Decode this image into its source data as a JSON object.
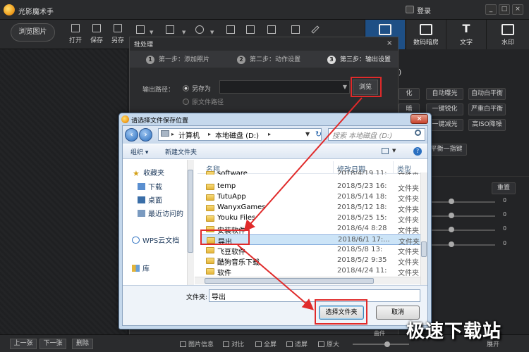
{
  "window": {
    "title": "光影魔术手",
    "login": "登录",
    "controls": [
      "_",
      "□",
      "×"
    ]
  },
  "toolbar": {
    "browse_pictures": "浏览图片",
    "items": [
      "打开",
      "保存",
      "另存"
    ],
    "right_tabs": [
      {
        "label": "",
        "icon": "edit-icon",
        "active": true
      },
      {
        "label": "数码暗房",
        "icon": "camera-icon",
        "active": false
      },
      {
        "label": "文字",
        "icon": "text-icon",
        "active": false
      },
      {
        "label": "水印",
        "icon": "watermark-icon",
        "active": false
      }
    ]
  },
  "right_panel": {
    "buttons": [
      "自动曝光",
      "自动白平衡",
      "一键锐化",
      "严重白平衡",
      "一键减光",
      "高ISO降噪"
    ],
    "partial_buttons": [
      "化",
      "暗",
      "平衡一指键"
    ],
    "reset": "重置",
    "slider_values": [
      "0",
      "0",
      "0",
      "0",
      "0"
    ]
  },
  "batch": {
    "title": "批处理",
    "close": "×",
    "steps": [
      {
        "num": "1",
        "label": "第一步：添加照片",
        "active": false
      },
      {
        "num": "2",
        "label": "第二步：动作设置",
        "active": false
      },
      {
        "num": "3",
        "label": "第三步：输出设置",
        "active": true
      }
    ],
    "output_path_label": "输出路径：",
    "save_as": "另存为",
    "original_path": "原文件路径",
    "browse": "浏览"
  },
  "file_dialog": {
    "title": "请选择文件保存位置",
    "breadcrumb": [
      "计算机",
      "本地磁盘 (D:)"
    ],
    "search_placeholder": "搜索 本地磁盘 (D:)",
    "organize": "组织 ▾",
    "new_folder": "新建文件夹",
    "nav": {
      "favorites": "收藏夹",
      "items": [
        "下载",
        "桌面",
        "最近访问的"
      ],
      "wps": "WPS云文档",
      "library": "库"
    },
    "columns": [
      "名称",
      "修改日期",
      "类型"
    ],
    "files": [
      {
        "name": "software",
        "date": "2018/4/19 11:",
        "type": "文件夹",
        "selected": false
      },
      {
        "name": "temp",
        "date": "2018/5/23 16:",
        "type": "文件夹",
        "selected": false
      },
      {
        "name": "TutuApp",
        "date": "2018/5/14 18:",
        "type": "文件夹",
        "selected": false
      },
      {
        "name": "WanyxGames",
        "date": "2018/5/12 18:",
        "type": "文件夹",
        "selected": false
      },
      {
        "name": "Youku Files",
        "date": "2018/5/25 15:",
        "type": "文件夹",
        "selected": false
      },
      {
        "name": "安装软件",
        "date": "2018/6/4 8:28",
        "type": "文件夹",
        "selected": false
      },
      {
        "name": "导出",
        "date": "2018/6/1 17:...",
        "type": "文件夹",
        "selected": true
      },
      {
        "name": "飞豆软件",
        "date": "2018/5/8 13:",
        "type": "文件夹",
        "selected": false
      },
      {
        "name": "酷狗音乐下载",
        "date": "2018/5/2 9:35",
        "type": "文件夹",
        "selected": false
      },
      {
        "name": "软件",
        "date": "2018/4/24 11:",
        "type": "文件夹",
        "selected": false
      }
    ],
    "filename_label": "文件夹:",
    "filename_value": "导出",
    "select_folder": "选择文件夹",
    "cancel": "取消"
  },
  "bottom": {
    "prev": "上一张",
    "next": "下一张",
    "delete": "删除",
    "tools": [
      "图片信息",
      "对比",
      "全屏",
      "适屏",
      "原大"
    ],
    "partial_label": "曲件",
    "partial_right": "展开"
  },
  "watermark": "极速下载站",
  "colors": {
    "accent_tab": "#1e4f85",
    "highlight_red": "#e02a2a",
    "selection": "#cce4f7"
  }
}
